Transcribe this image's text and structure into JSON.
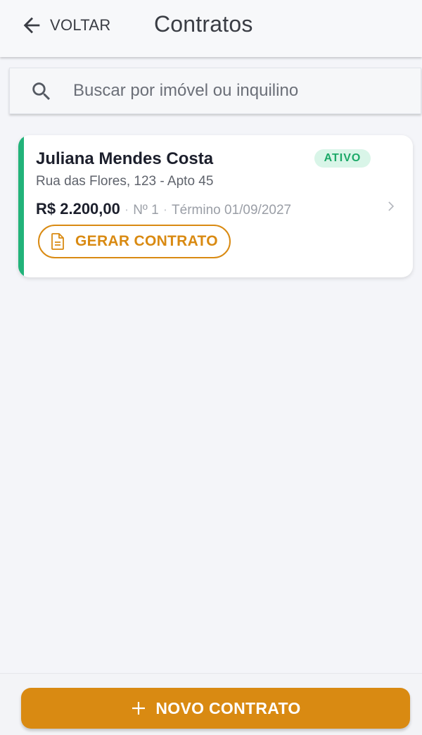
{
  "header": {
    "back_label": "VOLTAR",
    "title": "Contratos"
  },
  "search": {
    "placeholder": "Buscar por imóvel ou inquilino",
    "value": ""
  },
  "contracts": [
    {
      "tenant": "Juliana Mendes Costa",
      "status": "ATIVO",
      "address": "Rua das Flores, 123 - Apto 45",
      "rent": "R$ 2.200,00",
      "number": "Nº 1",
      "end": "Término 01/09/2027",
      "generate_label": "GERAR CONTRATO"
    }
  ],
  "footer": {
    "new_contract_label": "NOVO CONTRATO"
  },
  "icons": {
    "back": "arrow-left-icon",
    "search": "search-icon",
    "document": "document-icon",
    "chevron": "chevron-right-icon",
    "plus": "plus-icon"
  },
  "colors": {
    "accent": "#d98a12",
    "status_active": "#22b37a",
    "status_badge_bg": "#d9f5e8",
    "status_badge_text": "#1da968",
    "background": "#f4f5f9"
  }
}
